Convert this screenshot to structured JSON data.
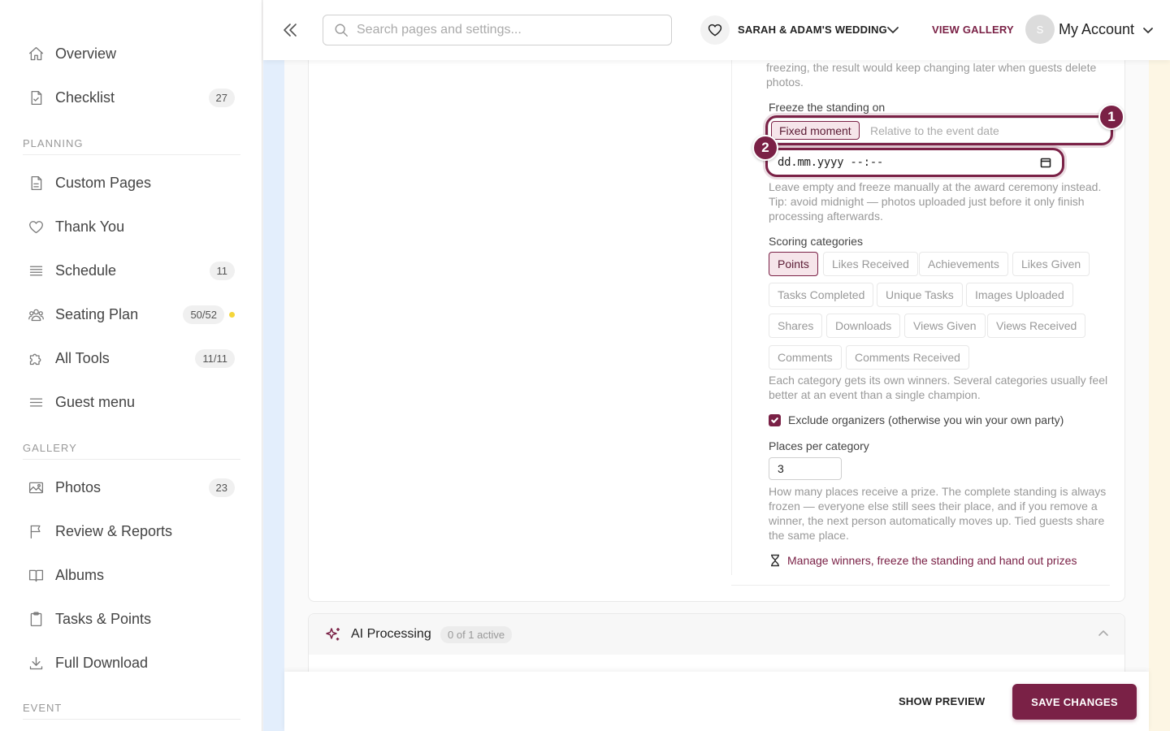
{
  "sidebar": {
    "items": [
      {
        "label": "Overview",
        "icon": "home-icon"
      },
      {
        "label": "Checklist",
        "icon": "checklist-icon",
        "badge": "27"
      },
      {
        "label": "Custom Pages",
        "icon": "document-icon"
      },
      {
        "label": "Thank You",
        "icon": "heart-icon"
      },
      {
        "label": "Schedule",
        "icon": "list-icon",
        "badge": "11"
      },
      {
        "label": "Seating Plan",
        "icon": "people-icon",
        "badge": "50/52",
        "status_color": "#f5d63a"
      },
      {
        "label": "All Tools",
        "icon": "puzzle-icon",
        "badge": "11/11"
      },
      {
        "label": "Guest menu",
        "icon": "menu-icon"
      },
      {
        "label": "Photos",
        "icon": "image-icon",
        "badge": "23"
      },
      {
        "label": "Review & Reports",
        "icon": "flag-icon"
      },
      {
        "label": "Albums",
        "icon": "book-icon"
      },
      {
        "label": "Tasks & Points",
        "icon": "clipboard-icon"
      },
      {
        "label": "Full Download",
        "icon": "download-icon"
      }
    ],
    "sections": {
      "planning": "PLANNING",
      "gallery": "GALLERY",
      "event": "EVENT"
    }
  },
  "topbar": {
    "search_placeholder": "Search pages and settings...",
    "event_name": "SARAH & ADAM'S WEDDING",
    "view_gallery": "VIEW GALLERY",
    "avatar_initial": "S",
    "account_label": "My Account"
  },
  "settings": {
    "intro_help": "freezing, the result would keep changing later when guests delete photos.",
    "freeze_label": "Freeze the standing on",
    "freeze_options": [
      "Fixed moment",
      "Relative to the event date"
    ],
    "freeze_selected": "Fixed moment",
    "date_placeholder": "dd.mm.yyyy --:--",
    "date_help": "Leave empty and freeze manually at the award ceremony instead. Tip: avoid midnight — photos uploaded just before it only finish processing afterwards.",
    "scoring_label": "Scoring categories",
    "categories": [
      "Points",
      "Likes Received",
      "Achievements",
      "Likes Given",
      "Tasks Completed",
      "Unique Tasks",
      "Images Uploaded",
      "Shares",
      "Downloads",
      "Views Given",
      "Views Received",
      "Comments",
      "Comments Received"
    ],
    "selected_category": "Points",
    "categories_help": "Each category gets its own winners. Several categories usually feel better at an event than a single champion.",
    "exclude_label": "Exclude organizers (otherwise you win your own party)",
    "exclude_checked": true,
    "places_label": "Places per category",
    "places_value": "3",
    "places_help": "How many places receive a prize. The complete standing is always frozen — everyone else still sees their place, and if you remove a winner, the next person automatically moves up. Tied guests share the same place.",
    "manage_link": "Manage winners, freeze the standing and hand out prizes"
  },
  "annotations": {
    "marker1": "1",
    "marker2": "2"
  },
  "ai_processing": {
    "title": "AI Processing",
    "badge": "0 of 1 active"
  },
  "footer": {
    "show_preview": "SHOW PREVIEW",
    "save": "SAVE CHANGES"
  },
  "colors": {
    "accent": "#7a2146",
    "accent_light": "#f6e5ea"
  }
}
